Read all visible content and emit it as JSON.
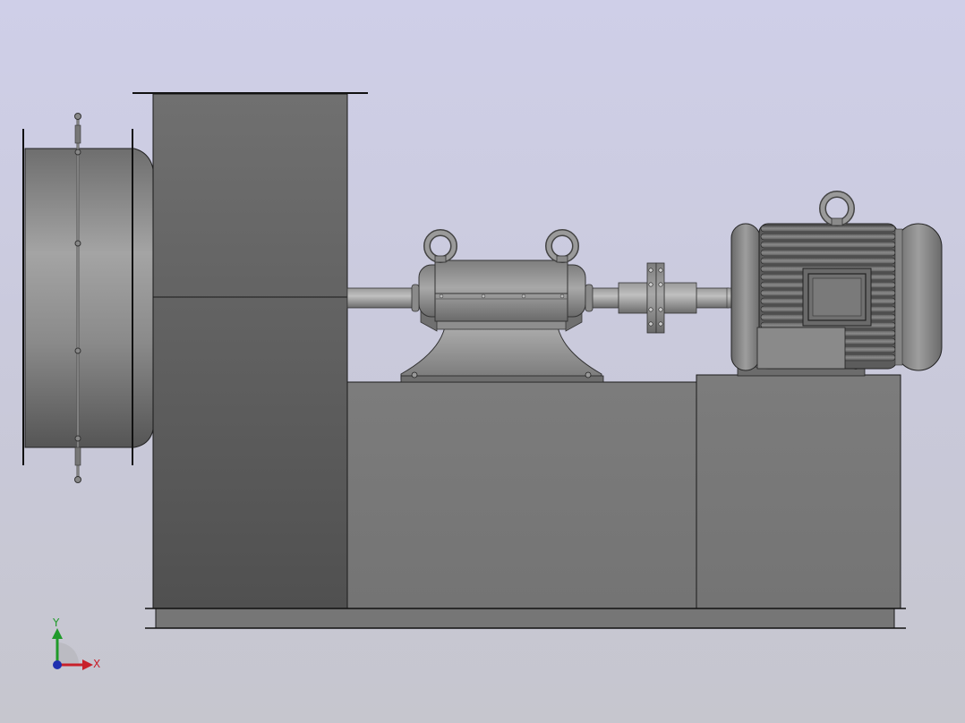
{
  "viewport": {
    "background_top": "#cfcfe8",
    "background_bottom": "#c6c6ce",
    "model_color": "#7a7a7a",
    "edge_color": "#1a1a1a"
  },
  "triad": {
    "x_label": "X",
    "y_label": "Y",
    "x_color": "#c8202a",
    "y_color": "#1f9a2a",
    "z_color": "#1f2fb0"
  }
}
